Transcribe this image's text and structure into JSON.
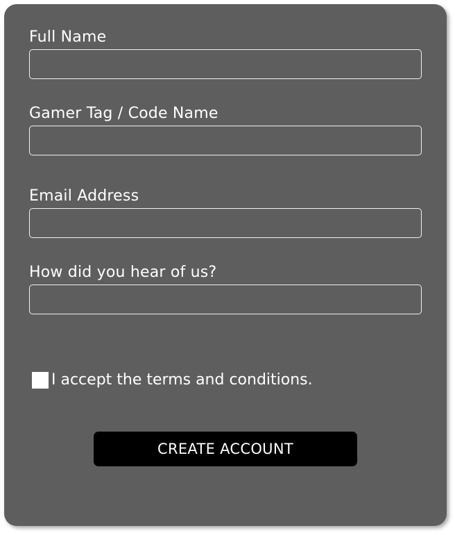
{
  "form": {
    "fields": [
      {
        "label": "Full Name",
        "value": "",
        "placeholder": ""
      },
      {
        "label": "Gamer Tag / Code Name",
        "value": "",
        "placeholder": ""
      },
      {
        "label": "Email Address",
        "value": "",
        "placeholder": ""
      },
      {
        "label": "How did you hear of us?",
        "value": "",
        "placeholder": ""
      }
    ],
    "terms_label": "I accept the terms and conditions.",
    "terms_checked": false,
    "submit_label": "CREATE ACCOUNT"
  },
  "colors": {
    "panel_background": "#5e5e5e",
    "text": "#ffffff",
    "field_border": "#f2f2f2",
    "button_background": "#000000",
    "checkbox_fill": "#ffffff"
  }
}
